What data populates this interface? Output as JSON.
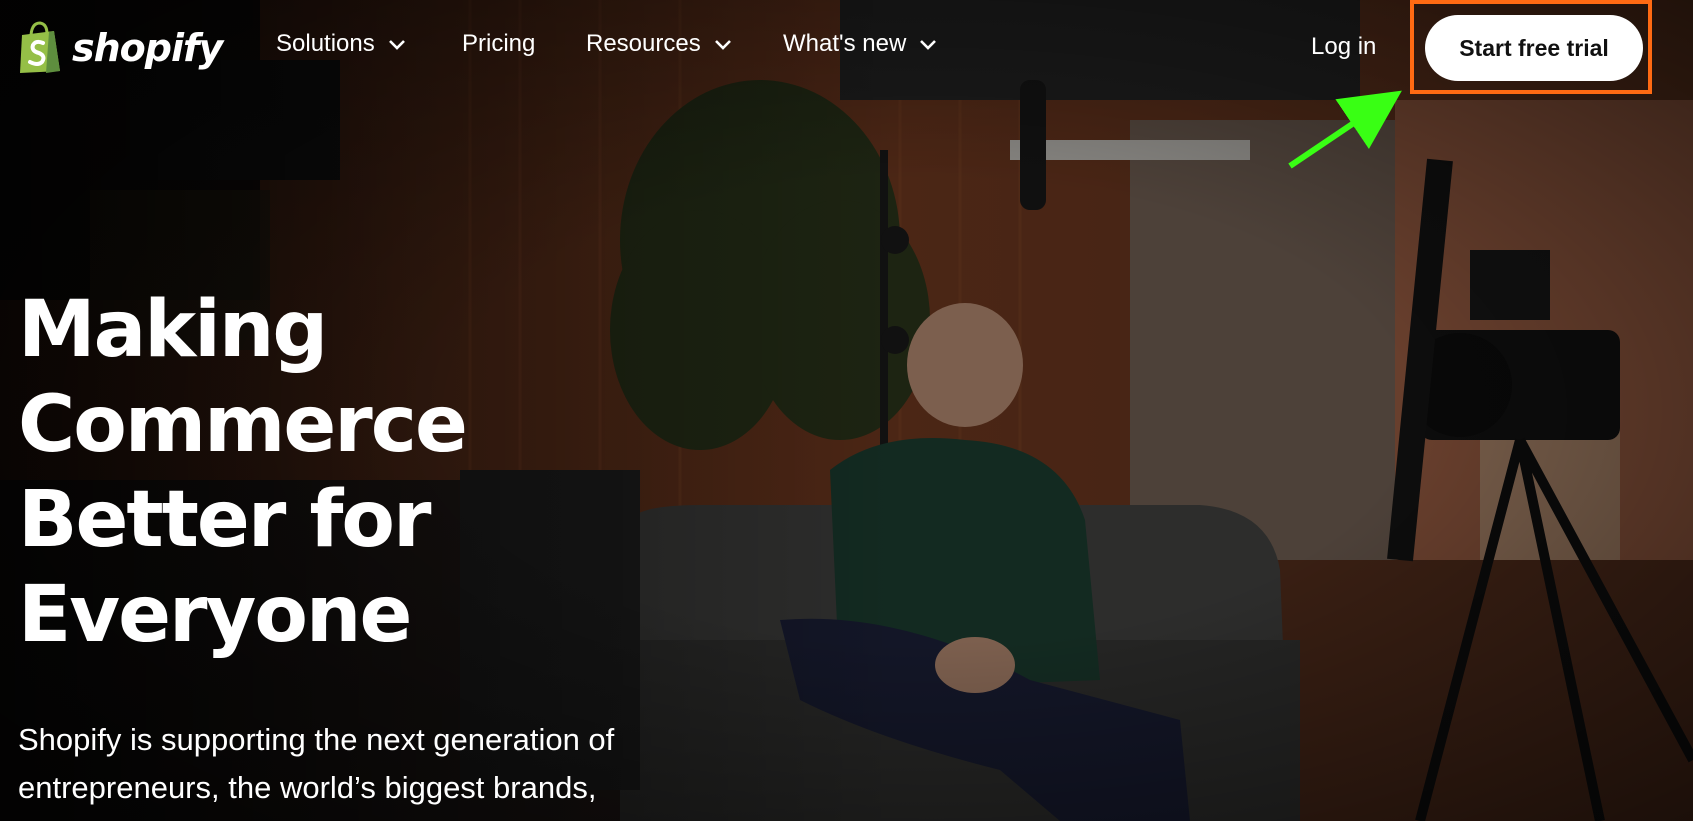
{
  "brand": {
    "name": "shopify",
    "accent": "#95bf47"
  },
  "nav": {
    "items": [
      {
        "label": "Solutions",
        "has_dropdown": true
      },
      {
        "label": "Pricing",
        "has_dropdown": false
      },
      {
        "label": "Resources",
        "has_dropdown": true
      },
      {
        "label": "What's new",
        "has_dropdown": true
      }
    ],
    "login_label": "Log in",
    "cta_label": "Start free trial"
  },
  "annotation": {
    "highlight_color": "#ff6a13",
    "arrow_color": "#39ff14"
  },
  "hero": {
    "title_lines": [
      "Making",
      "Commerce",
      "Better for",
      "Everyone"
    ],
    "subtitle_lines": [
      "Shopify is supporting the next generation of",
      "entrepreneurs, the world’s biggest brands,"
    ]
  },
  "icons": [
    "shopify-bag-icon",
    "chevron-down-icon"
  ]
}
